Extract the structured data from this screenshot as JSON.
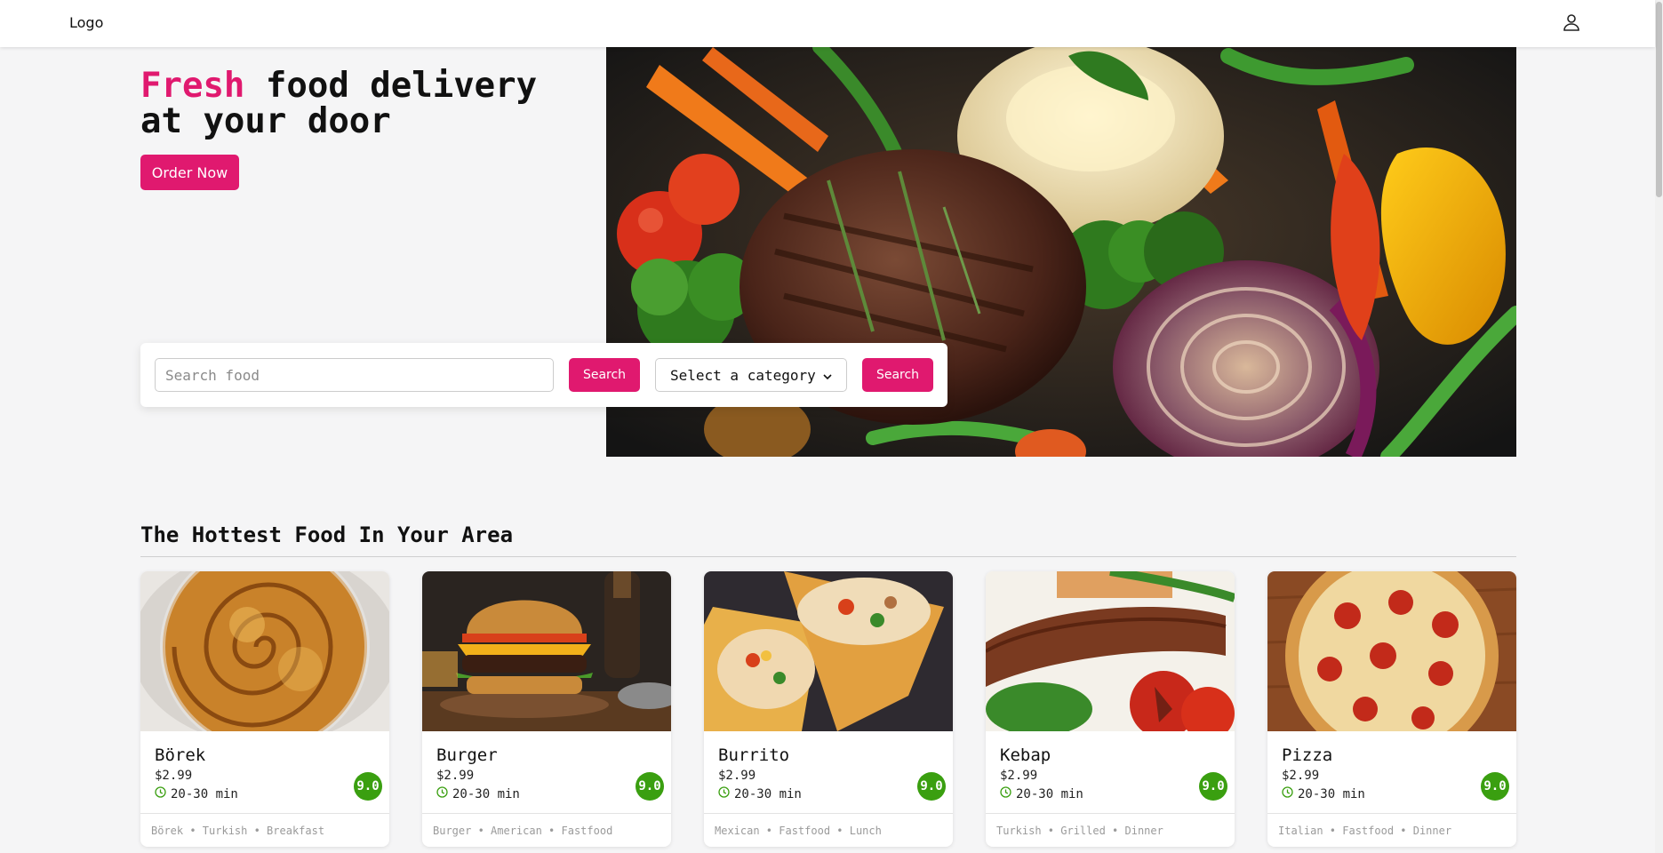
{
  "navbar": {
    "logo": "Logo",
    "user_icon": "user-icon"
  },
  "hero": {
    "title_accent": "Fresh",
    "title_rest_line1": " food delivery",
    "title_line2": "at your door",
    "order_button": "Order Now",
    "image": "steak-vegetables-photo"
  },
  "search": {
    "placeholder": "Search food",
    "search_button": "Search",
    "category_selected": "Select a category",
    "category_search_button": "Search"
  },
  "section": {
    "title": "The Hottest Food In Your Area"
  },
  "colors": {
    "accent": "#e0196f",
    "rating": "#3a9f10"
  },
  "foods": [
    {
      "name": "Börek",
      "price": "$2.99",
      "time": "20-30 min",
      "rating": "9.0",
      "tags": "Börek • Turkish • Breakfast",
      "image": "borek-photo"
    },
    {
      "name": "Burger",
      "price": "$2.99",
      "time": "20-30 min",
      "rating": "9.0",
      "tags": "Burger • American • Fastfood",
      "image": "burger-photo"
    },
    {
      "name": "Burrito",
      "price": "$2.99",
      "time": "20-30 min",
      "rating": "9.0",
      "tags": "Mexican • Fastfood • Lunch",
      "image": "burrito-photo"
    },
    {
      "name": "Kebap",
      "price": "$2.99",
      "time": "20-30 min",
      "rating": "9.0",
      "tags": "Turkish • Grilled • Dinner",
      "image": "kebap-photo"
    },
    {
      "name": "Pizza",
      "price": "$2.99",
      "time": "20-30 min",
      "rating": "9.0",
      "tags": "Italian • Fastfood • Dinner",
      "image": "pizza-photo"
    }
  ]
}
